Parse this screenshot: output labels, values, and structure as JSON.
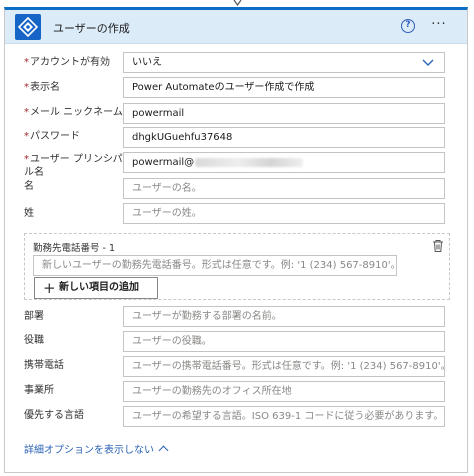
{
  "header": {
    "title": "ユーザーの作成",
    "help_label": "?",
    "more_label": "···"
  },
  "fields": {
    "account_enabled": {
      "label": "アカウントが有効",
      "value": "いいえ"
    },
    "display_name": {
      "label": "表示名",
      "value": "Power Automateのユーザー作成で作成"
    },
    "mail_nickname": {
      "label": "メール ニックネーム",
      "value": "powermail"
    },
    "password": {
      "label": "パスワード",
      "value": "dhgkUGuehfu37648"
    },
    "upn": {
      "label_line1": "ユーザー プリンシパ",
      "label_line2": "ル名",
      "value": "powermail@"
    },
    "given_name": {
      "label": "名",
      "placeholder": "ユーザーの名。"
    },
    "surname": {
      "label": "姓",
      "placeholder": "ユーザーの姓。"
    },
    "department": {
      "label": "部署",
      "placeholder": "ユーザーが勤務する部署の名前。"
    },
    "job_title": {
      "label": "役職",
      "placeholder": "ユーザーの役職。"
    },
    "mobile_phone": {
      "label": "携帯電話",
      "placeholder": "ユーザーの携帯電話番号。形式は任意です。例: '1 (234) 567-8910'。"
    },
    "office": {
      "label": "事業所",
      "placeholder": "ユーザーの勤務先のオフィス所在地"
    },
    "language": {
      "label": "優先する言語",
      "placeholder": "ユーザーの希望する言語。ISO 639-1 コードに従う必要があります。例: 'en-US'"
    }
  },
  "business_phones": {
    "label": "勤務先電話番号 - 1",
    "placeholder": "新しいユーザーの勤務先電話番号。形式は任意です。例: '1 (234) 567-8910'。",
    "add_label": "新しい項目の追加"
  },
  "advanced_label": "詳細オプションを表示しない",
  "required_mark": "*",
  "colors": {
    "accent": "#0b6ec4",
    "header_bg": "#dcebf8",
    "link": "#2b63b7",
    "required": "#a4262c"
  }
}
